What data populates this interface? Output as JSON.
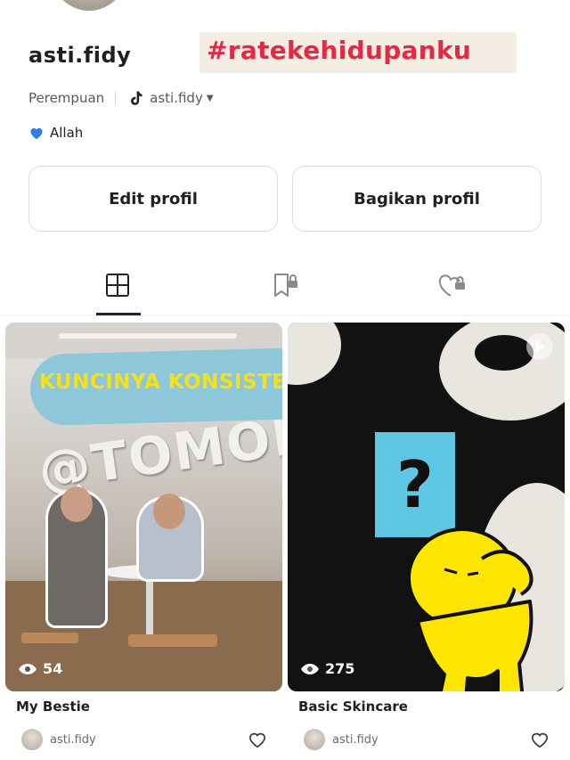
{
  "profile": {
    "username": "asti.fidy",
    "hashtag": "#ratekehidupanku",
    "gender": "Perempuan",
    "tiktok_handle": "asti.fidy",
    "bio": "Allah",
    "edit_label": "Edit profil",
    "share_label": "Bagikan profil"
  },
  "tabs": [
    {
      "name": "posts",
      "icon": "grid-icon",
      "active": true
    },
    {
      "name": "saved",
      "icon": "bookmark-lock-icon",
      "active": false
    },
    {
      "name": "liked",
      "icon": "heart-lock-icon",
      "active": false
    }
  ],
  "posts": [
    {
      "overlay_text": "KUNCINYA KONSISTEN YUK.",
      "views": "54",
      "title": "My Bestie",
      "author": "asti.fidy",
      "sign_text": "@TOMORO"
    },
    {
      "views": "275",
      "title": "Basic Skincare",
      "author": "asti.fidy",
      "question_mark": "?"
    }
  ],
  "colors": {
    "hashtag": "#e22a45",
    "overlay_banner": "#8fc7da",
    "overlay_text": "#f5e11b",
    "cyan_card": "#5fc7e3",
    "yellow_char": "#ffe600"
  }
}
